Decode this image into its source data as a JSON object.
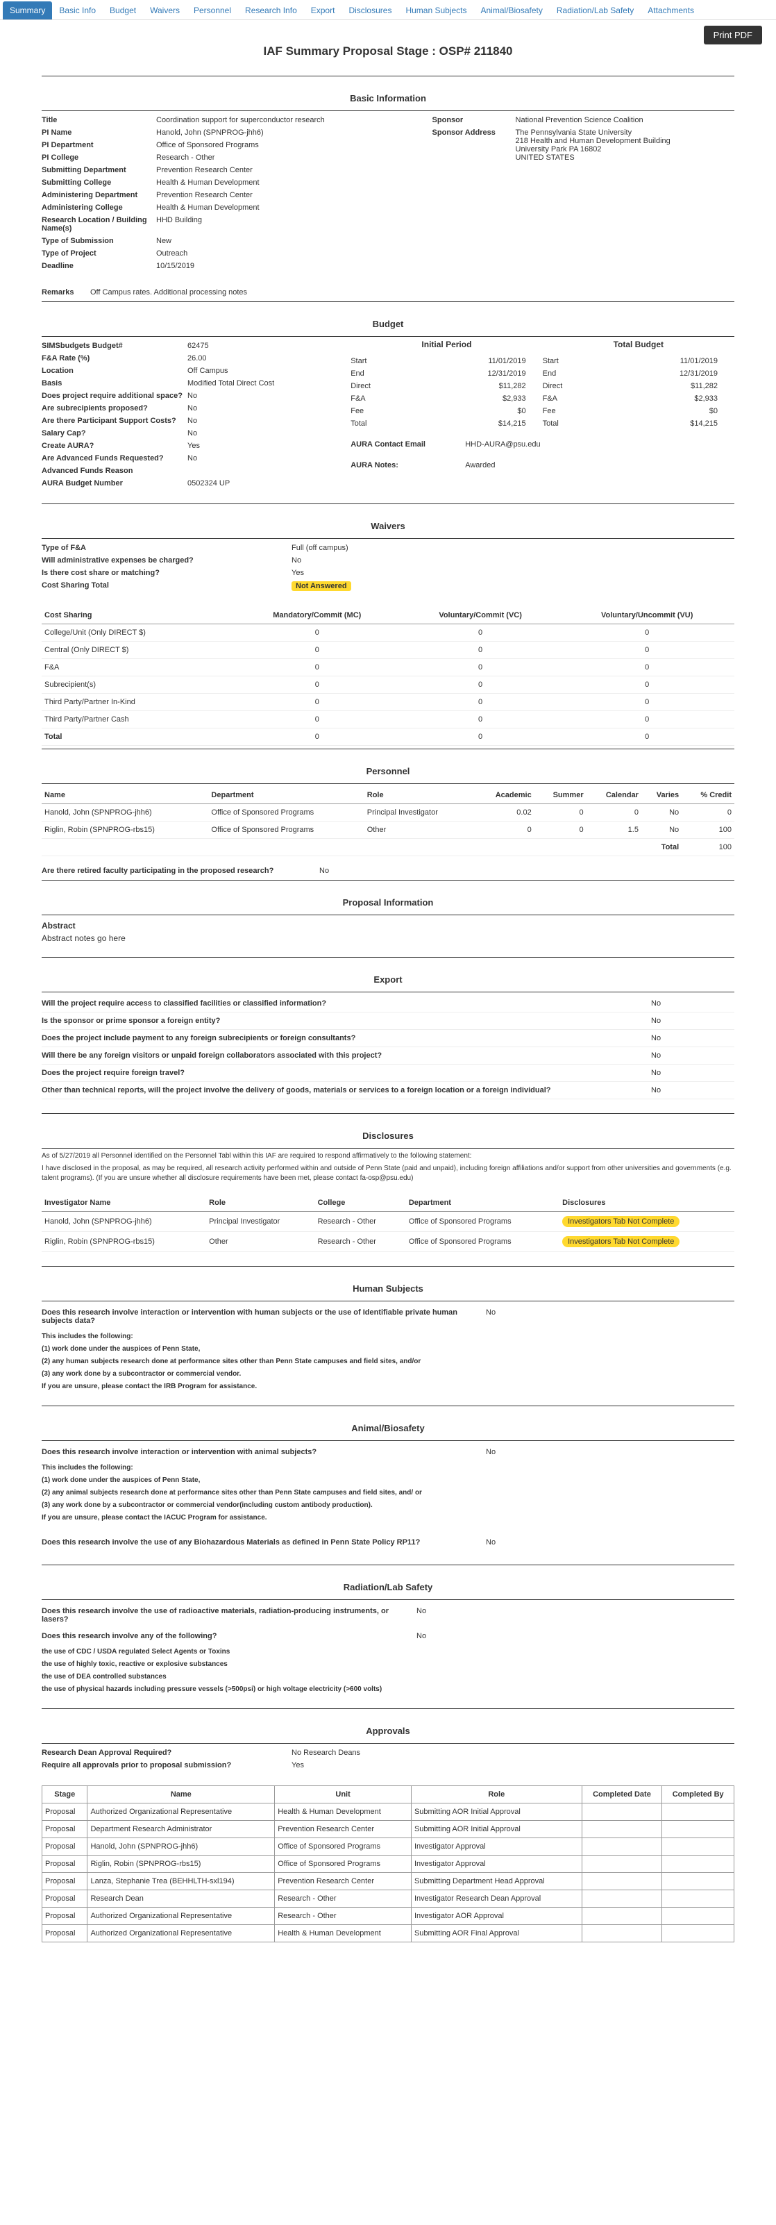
{
  "tabs": [
    "Summary",
    "Basic Info",
    "Budget",
    "Waivers",
    "Personnel",
    "Research Info",
    "Export",
    "Disclosures",
    "Human Subjects",
    "Animal/Biosafety",
    "Radiation/Lab Safety",
    "Attachments"
  ],
  "print_btn": "Print PDF",
  "page_title": "IAF Summary Proposal Stage : OSP# 211840",
  "sections": {
    "basic": "Basic Information",
    "budget": "Budget",
    "waivers": "Waivers",
    "personnel": "Personnel",
    "proposal": "Proposal Information",
    "export": "Export",
    "disclosures": "Disclosures",
    "human": "Human Subjects",
    "animal": "Animal/Biosafety",
    "radiation": "Radiation/Lab Safety",
    "approvals": "Approvals"
  },
  "basic": {
    "left": [
      {
        "l": "Title",
        "v": "Coordination support for superconductor research"
      },
      {
        "l": "PI Name",
        "v": "Hanold, John (SPNPROG-jhh6)"
      },
      {
        "l": "PI Department",
        "v": "Office of Sponsored Programs"
      },
      {
        "l": "PI College",
        "v": "Research - Other"
      },
      {
        "l": "Submitting Department",
        "v": "Prevention Research Center"
      },
      {
        "l": "Submitting College",
        "v": "Health & Human Development"
      },
      {
        "l": "Administering Department",
        "v": "Prevention Research Center"
      },
      {
        "l": "Administering College",
        "v": "Health & Human Development"
      },
      {
        "l": "Research Location / Building Name(s)",
        "v": "HHD Building"
      },
      {
        "l": "Type of Submission",
        "v": "New"
      },
      {
        "l": "Type of Project",
        "v": "Outreach"
      },
      {
        "l": "Deadline",
        "v": "10/15/2019"
      }
    ],
    "remarks_l": "Remarks",
    "remarks_v": "Off Campus rates. Additional processing notes",
    "sponsor_l": "Sponsor",
    "sponsor_v": "National Prevention Science Coalition",
    "sponsor_addr_l": "Sponsor Address",
    "sponsor_addr": [
      "The Pennsylvania State University",
      "218 Health and Human Development Building",
      "University Park PA 16802",
      "UNITED STATES"
    ]
  },
  "budget": {
    "left": [
      {
        "l": "SIMSbudgets Budget#",
        "v": "62475"
      },
      {
        "l": "F&A Rate (%)",
        "v": "26.00"
      },
      {
        "l": "Location",
        "v": "Off Campus"
      },
      {
        "l": "Basis",
        "v": "Modified Total Direct Cost"
      },
      {
        "l": "Does project require additional space?",
        "v": "No"
      },
      {
        "l": "Are subrecipients proposed?",
        "v": "No"
      },
      {
        "l": "Are there Participant Support Costs?",
        "v": "No"
      },
      {
        "l": "Salary Cap?",
        "v": "No"
      },
      {
        "l": "Create AURA?",
        "v": "Yes"
      },
      {
        "l": "Are Advanced Funds Requested?",
        "v": "No"
      },
      {
        "l": "Advanced Funds Reason",
        "v": ""
      },
      {
        "l": "AURA Budget Number",
        "v": "0502324 UP"
      }
    ],
    "initial_h": "Initial Period",
    "total_h": "Total Budget",
    "rows": [
      "Start",
      "End",
      "Direct",
      "F&A",
      "Fee",
      "Total"
    ],
    "initial": [
      "11/01/2019",
      "12/31/2019",
      "$11,282",
      "$2,933",
      "$0",
      "$14,215"
    ],
    "total": [
      "11/01/2019",
      "12/31/2019",
      "$11,282",
      "$2,933",
      "$0",
      "$14,215"
    ],
    "aura_email_l": "AURA Contact Email",
    "aura_email_v": "HHD-AURA@psu.edu",
    "aura_notes_l": "AURA Notes:",
    "aura_notes_v": "Awarded"
  },
  "waivers": {
    "fields": [
      {
        "l": "Type of F&A",
        "v": "Full (off campus)"
      },
      {
        "l": "Will administrative expenses be charged?",
        "v": "No"
      },
      {
        "l": "Is there cost share or matching?",
        "v": "Yes"
      },
      {
        "l": "Cost Sharing Total",
        "v": "__NOT_ANSWERED__"
      }
    ],
    "cs_h": "Cost Sharing",
    "mc_h": "Mandatory/Commit (MC)",
    "vc_h": "Voluntary/Commit (VC)",
    "vu_h": "Voluntary/Uncommit (VU)",
    "cs_rows": [
      {
        "n": "College/Unit (Only DIRECT $)",
        "mc": "0",
        "vc": "0",
        "vu": "0"
      },
      {
        "n": "Central (Only DIRECT $)",
        "mc": "0",
        "vc": "0",
        "vu": "0"
      },
      {
        "n": "F&A",
        "mc": "0",
        "vc": "0",
        "vu": "0"
      },
      {
        "n": "Subrecipient(s)",
        "mc": "0",
        "vc": "0",
        "vu": "0"
      },
      {
        "n": "Third Party/Partner In-Kind",
        "mc": "0",
        "vc": "0",
        "vu": "0"
      },
      {
        "n": "Third Party/Partner Cash",
        "mc": "0",
        "vc": "0",
        "vu": "0"
      },
      {
        "n": "Total",
        "mc": "0",
        "vc": "0",
        "vu": "0"
      }
    ],
    "not_answered": "Not Answered"
  },
  "personnel": {
    "cols": [
      "Name",
      "Department",
      "Role",
      "Academic",
      "Summer",
      "Calendar",
      "Varies",
      "% Credit"
    ],
    "rows": [
      [
        "Hanold, John (SPNPROG-jhh6)",
        "Office of Sponsored Programs",
        "Principal Investigator",
        "0.02",
        "0",
        "0",
        "No",
        "0"
      ],
      [
        "Riglin, Robin (SPNPROG-rbs15)",
        "Office of Sponsored Programs",
        "Other",
        "0",
        "0",
        "1.5",
        "No",
        "100"
      ]
    ],
    "total_l": "Total",
    "total_v": "100",
    "retired_q": "Are there retired faculty participating in the proposed research?",
    "retired_a": "No"
  },
  "proposal": {
    "abstract_l": "Abstract",
    "abstract_v": "Abstract notes go here"
  },
  "export": {
    "rows": [
      {
        "q": "Will the project require access to classified facilities or classified information?",
        "a": "No"
      },
      {
        "q": "Is the sponsor or prime sponsor a foreign entity?",
        "a": "No"
      },
      {
        "q": "Does the project include payment to any foreign subrecipients or foreign consultants?",
        "a": "No"
      },
      {
        "q": "Will there be any foreign visitors or unpaid foreign collaborators associated with this project?",
        "a": "No"
      },
      {
        "q": "Does the project require foreign travel?",
        "a": "No"
      },
      {
        "q": "Other than technical reports, will the project involve the delivery of goods, materials or services to a foreign location or a foreign individual?",
        "a": "No"
      }
    ]
  },
  "disclosures": {
    "intro": "As of 5/27/2019 all Personnel identified on the Personnel Tabl within this IAF are required to respond affirmatively to the following statement:",
    "intro2": "I have disclosed in the proposal, as may be required, all research activity performed within and outside of Penn State (paid and unpaid), including foreign affiliations and/or support from other universities and governments (e.g. talent programs). (If you are unsure whether all disclosure requirements have been met, please contact fa-osp@psu.edu)",
    "cols": [
      "Investigator Name",
      "Role",
      "College",
      "Department",
      "Disclosures"
    ],
    "rows": [
      [
        "Hanold, John (SPNPROG-jhh6)",
        "Principal Investigator",
        "Research - Other",
        "Office of Sponsored Programs",
        "Investigators Tab Not Complete"
      ],
      [
        "Riglin, Robin (SPNPROG-rbs15)",
        "Other",
        "Research - Other",
        "Office of Sponsored Programs",
        "Investigators Tab Not Complete"
      ]
    ]
  },
  "human": {
    "q": "Does this research involve interaction or intervention with human subjects or the use of Identifiable private human subjects data?",
    "a": "No",
    "sub": [
      "This includes the following:",
      "(1) work done under the auspices of Penn State,",
      "(2) any human subjects research done at performance sites other than Penn State campuses and field sites, and/or",
      "(3) any work done by a subcontractor or commercial vendor.",
      "If you are unsure, please contact the IRB Program for assistance."
    ]
  },
  "animal": {
    "q1": "Does this research involve interaction or intervention with animal subjects?",
    "a1": "No",
    "sub": [
      "This includes the following:",
      "(1) work done under the auspices of Penn State,",
      "(2) any animal subjects research done at performance sites other than Penn State campuses and field sites, and/ or",
      "(3) any work done by a subcontractor or commercial vendor(including custom antibody production).",
      "If you are unsure, please contact the IACUC Program for assistance."
    ],
    "q2": "Does this research involve the use of any Biohazardous Materials as defined in Penn State Policy RP11?",
    "a2": "No"
  },
  "radiation": {
    "q1": "Does this research involve the use of radioactive materials, radiation-producing instruments, or lasers?",
    "a1": "No",
    "q2": "Does this research involve any of the following?",
    "a2": "No",
    "sub": [
      "the use of CDC / USDA regulated Select Agents or Toxins",
      "the use of highly toxic, reactive or explosive substances",
      "the use of DEA controlled substances",
      "the use of physical hazards including pressure vessels (>500psi) or high voltage electricity (>600 volts)"
    ]
  },
  "approvals": {
    "pre": [
      {
        "l": "Research Dean Approval Required?",
        "v": "No Research Deans"
      },
      {
        "l": "Require all approvals prior to proposal submission?",
        "v": "Yes"
      }
    ],
    "cols": [
      "Stage",
      "Name",
      "Unit",
      "Role",
      "Completed Date",
      "Completed By"
    ],
    "rows": [
      [
        "Proposal",
        "Authorized Organizational Representative",
        "Health & Human Development",
        "Submitting AOR Initial Approval",
        "",
        ""
      ],
      [
        "Proposal",
        "Department Research Administrator",
        "Prevention Research Center",
        "Submitting AOR Initial Approval",
        "",
        ""
      ],
      [
        "Proposal",
        "Hanold, John (SPNPROG-jhh6)",
        "Office of Sponsored Programs",
        "Investigator Approval",
        "",
        ""
      ],
      [
        "Proposal",
        "Riglin, Robin (SPNPROG-rbs15)",
        "Office of Sponsored Programs",
        "Investigator Approval",
        "",
        ""
      ],
      [
        "Proposal",
        "Lanza, Stephanie Trea (BEHHLTH-sxl194)",
        "Prevention Research Center",
        "Submitting Department Head Approval",
        "",
        ""
      ],
      [
        "Proposal",
        "Research Dean",
        "Research - Other",
        "Investigator Research Dean Approval",
        "",
        ""
      ],
      [
        "Proposal",
        "Authorized Organizational Representative",
        "Research - Other",
        "Investigator AOR Approval",
        "",
        ""
      ],
      [
        "Proposal",
        "Authorized Organizational Representative",
        "Health & Human Development",
        "Submitting AOR Final Approval",
        "",
        ""
      ]
    ]
  }
}
